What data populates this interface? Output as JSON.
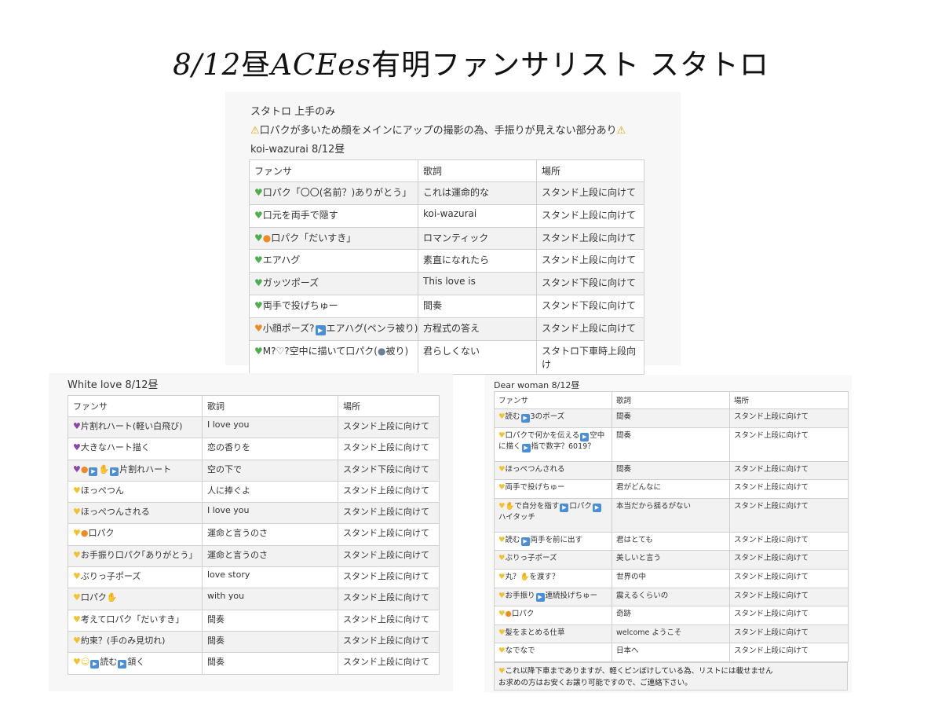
{
  "title": {
    "part1": "8/12",
    "part2": "昼",
    "part3": "ACEes",
    "part4": "有明ファンサリスト スタトロ"
  },
  "card1": {
    "line1": "スタトロ 上手のみ",
    "warn_text": "口パクが多いため顔をメインにアップの撮影の為、手振りが見えない部分あり",
    "song": "koi-wazurai 8/12昼",
    "headers": [
      "ファンサ",
      "歌詞",
      "場所"
    ],
    "rows": [
      {
        "icons": [
          "green-heart"
        ],
        "fansa": "口パク「〇〇(名前？)ありがとう」",
        "lyric": "これは運命的な",
        "place": "スタンド上段に向けて"
      },
      {
        "icons": [
          "green-heart"
        ],
        "fansa": "口元を両手で隠す",
        "lyric": "koi-wazurai",
        "place": "スタンド上段に向けて"
      },
      {
        "icons": [
          "green-heart",
          "mouth"
        ],
        "fansa": "口パク「だいすき」",
        "lyric": "ロマンティック",
        "place": "スタンド上段に向けて"
      },
      {
        "icons": [
          "green-heart"
        ],
        "fansa": "エアハグ",
        "lyric": "素直になれたら",
        "place": "スタンド上段に向けて"
      },
      {
        "icons": [
          "green-heart"
        ],
        "fansa": "ガッツポーズ",
        "lyric": "This love is",
        "place": "スタンド下段に向けて"
      },
      {
        "icons": [
          "green-heart"
        ],
        "fansa": "両手で投げちゅー",
        "lyric": "間奏",
        "place": "スタンド下段に向けて"
      },
      {
        "icons": [
          "orange-heart"
        ],
        "fansa": "小顔ポーズ?",
        "fansa2": "エアハグ(ペンラ被り)",
        "lyric": "方程式の答え",
        "place": "スタンド上段に向けて"
      },
      {
        "icons": [
          "green-heart"
        ],
        "fansa": "M?♡?空中に描いて口パク(",
        "fansa2": "被り)",
        "lyric": "君らしくない",
        "place": "スタトロ下車時上段向け"
      }
    ]
  },
  "card2": {
    "song": "White love 8/12昼",
    "headers": [
      "ファンサ",
      "歌詞",
      "場所"
    ],
    "rows": [
      {
        "fansa": "片割れハート(軽い白飛び)",
        "lyric": "I love you",
        "place": "スタンド上段に向けて"
      },
      {
        "fansa": "大きなハート描く",
        "lyric": "恋の香りを",
        "place": "スタンド上段に向けて"
      },
      {
        "fansa": "片割れハート",
        "lyric": "空の下で",
        "place": "スタンド下段に向けて"
      },
      {
        "fansa": "ほっぺつん",
        "lyric": "人に捧ぐよ",
        "place": "スタンド上段に向けて"
      },
      {
        "fansa": "ほっぺつんされる",
        "lyric": "I love you",
        "place": "スタンド上段に向けて"
      },
      {
        "fansa": "口パク",
        "lyric": "運命と言うのさ",
        "place": "スタンド上段に向けて"
      },
      {
        "fansa": "お手振り口パク｢ありがとう｣",
        "lyric": "運命と言うのさ",
        "place": "スタンド上段に向けて"
      },
      {
        "fansa": "ぶりっ子ポーズ",
        "lyric": "love story",
        "place": "スタンド上段に向けて"
      },
      {
        "fansa": "口パク",
        "lyric": "with you",
        "place": "スタンド上段に向けて"
      },
      {
        "fansa": "考えて口パク「だいすき」",
        "lyric": "間奏",
        "place": "スタンド上段に向けて"
      },
      {
        "fansa": "約束？(手のみ見切れ)",
        "lyric": "間奏",
        "place": "スタンド上段に向けて"
      },
      {
        "fansa": "読む",
        "fansa2": "頷く",
        "lyric": "間奏",
        "place": "スタンド上段に向けて"
      }
    ]
  },
  "card3": {
    "song": "Dear woman 8/12昼",
    "headers": [
      "ファンサ",
      "歌詞",
      "場所"
    ],
    "rows": [
      {
        "fansa": "読む",
        "fansa2": "3のポーズ",
        "lyric": "間奏",
        "place": "スタンド上段に向けて"
      },
      {
        "fansa": "口パクで何かを伝える",
        "fansa2": "空中に描く",
        "fansa3": "指で数字？6019？",
        "lyric": "間奏",
        "place": "スタンド上段に向けて"
      },
      {
        "fansa": "ほっぺつんされる",
        "lyric": "間奏",
        "place": "スタンド上段に向けて"
      },
      {
        "fansa": "両手で投げちゅー",
        "lyric": "君がどんなに",
        "place": "スタンド上段に向けて"
      },
      {
        "fansa": "で自分を指す",
        "fansa2": "口パク",
        "fansa3": "ハイタッチ",
        "lyric": "本当だから揺るがない",
        "place": "スタンド上段に向けて"
      },
      {
        "fansa": "読む",
        "fansa2": "両手を前に出す",
        "lyric": "君はとても",
        "place": "スタンド上段に向けて"
      },
      {
        "fansa": "ぶりっ子ポーズ",
        "lyric": "美しいと言う",
        "place": "スタンド上段に向けて"
      },
      {
        "fansa": "丸？",
        "fansa2": "を渡す？",
        "lyric": "世界の中",
        "place": "スタンド上段に向けて"
      },
      {
        "fansa": "お手振り",
        "fansa2": "連続投げちゅー",
        "lyric": "震えるくらいの",
        "place": "スタンド上段に向けて"
      },
      {
        "fansa": "口パク",
        "lyric": "奇跡",
        "place": "スタンド上段に向けて"
      },
      {
        "fansa": "髪をまとめる仕草",
        "lyric": "welcome ようこそ",
        "place": "スタンド上段に向けて"
      },
      {
        "fansa": "なでなで",
        "lyric": "日本へ",
        "place": "スタンド上段に向けて"
      }
    ],
    "note1": "これ以降下車までありますが、軽くピンぼけしている為、リストには載せません",
    "note2": "お求めの方はお安くお譲り可能ですので、ご連絡下さい。"
  },
  "colors": {
    "green_heart": "#4caf50",
    "yellow_heart": "#f2c230",
    "purple_heart": "#8e44ad",
    "orange_heart": "#f08a24",
    "play_button": "#4a8fd6"
  }
}
